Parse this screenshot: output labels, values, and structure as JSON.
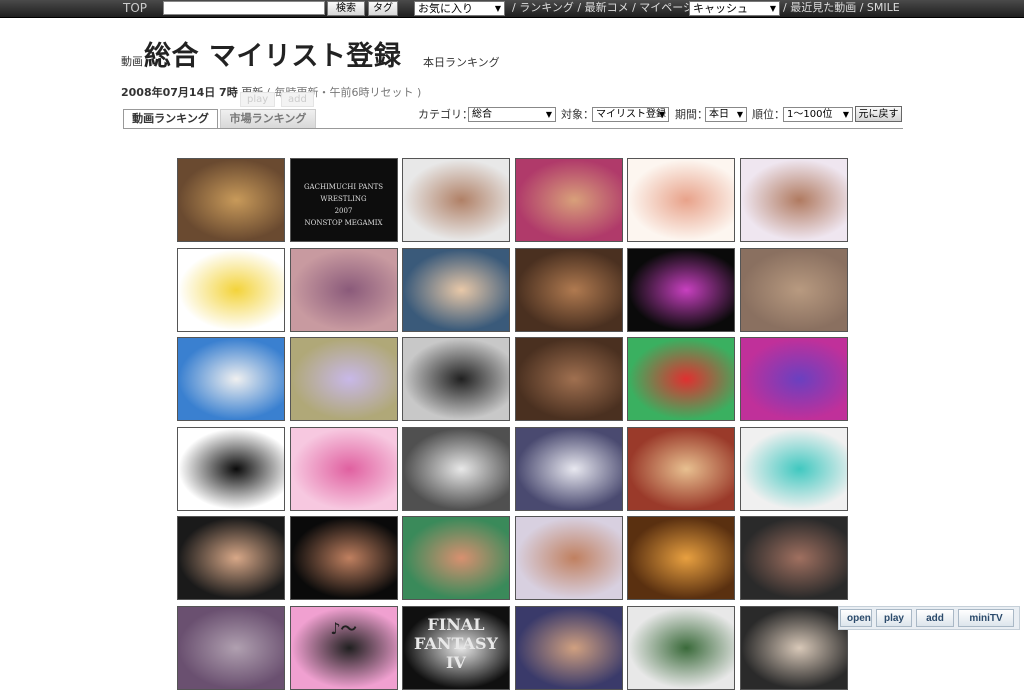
{
  "topbar": {
    "top_label": "TOP",
    "search_value": "",
    "search_button": "検索",
    "tag_button": "タグ",
    "favorites_select": "お気に入り",
    "links_text_1": "/ ランキング / 最新コメ / マイページ /",
    "cache_select": "キャッシュ",
    "links_text_2": "/ 最近見た動画 / SMILE"
  },
  "header": {
    "prefix": "動画",
    "title": "総合 マイリスト登録",
    "suffix": "本日ランキング",
    "date": "2008年07月14日 7時",
    "update_label": "更新",
    "update_note": "( 毎時更新・午前6時リセット )",
    "ghost_play": "play",
    "ghost_add": "add"
  },
  "tabs": [
    {
      "label": "動画ランキング",
      "active": true
    },
    {
      "label": "市場ランキング",
      "active": false
    }
  ],
  "filters": {
    "category_label": "カテゴリ：",
    "category_value": "総合",
    "target_label": "対象：",
    "target_value": "マイリスト登録",
    "period_label": "期間：",
    "period_value": "本日",
    "rank_label": "順位：",
    "rank_value": "1～100位",
    "reset_button": "元に戻す"
  },
  "thumbnails": [
    {
      "row": 0,
      "col": 0,
      "bg": "#6a4a30",
      "accent": "#c89a5a",
      "text": ""
    },
    {
      "row": 0,
      "col": 1,
      "bg": "#0d0d0d",
      "accent": "#0d0d0d",
      "text": "GACHIMUCHI PANTS WRESTLING\n2007\nNONSTOP MEGAMIX"
    },
    {
      "row": 0,
      "col": 2,
      "bg": "#e8e8e8",
      "accent": "#b08066",
      "text": ""
    },
    {
      "row": 0,
      "col": 3,
      "bg": "#b03a6a",
      "accent": "#d8a07a",
      "text": ""
    },
    {
      "row": 0,
      "col": 4,
      "bg": "#fdf6f0",
      "accent": "#e8a28a",
      "text": ""
    },
    {
      "row": 0,
      "col": 5,
      "bg": "#efe6f0",
      "accent": "#b07a60",
      "text": ""
    },
    {
      "row": 1,
      "col": 0,
      "bg": "#ffffff",
      "accent": "#f3d33a",
      "text": ""
    },
    {
      "row": 1,
      "col": 1,
      "bg": "#c89aa0",
      "accent": "#8a5a7a",
      "text": ""
    },
    {
      "row": 1,
      "col": 2,
      "bg": "#3a5a7a",
      "accent": "#e8c8a8",
      "text": ""
    },
    {
      "row": 1,
      "col": 3,
      "bg": "#4a3020",
      "accent": "#b07a50",
      "text": ""
    },
    {
      "row": 1,
      "col": 4,
      "bg": "#0a0a0a",
      "accent": "#c840c0",
      "text": ""
    },
    {
      "row": 1,
      "col": 5,
      "bg": "#8a7060",
      "accent": "#b89a80",
      "text": ""
    },
    {
      "row": 2,
      "col": 0,
      "bg": "#3a80d0",
      "accent": "#f0f0f0",
      "text": ""
    },
    {
      "row": 2,
      "col": 1,
      "bg": "#b0a878",
      "accent": "#c8b8e8",
      "text": ""
    },
    {
      "row": 2,
      "col": 2,
      "bg": "#c8c8c8",
      "accent": "#202020",
      "text": ""
    },
    {
      "row": 2,
      "col": 3,
      "bg": "#4a3020",
      "accent": "#a07050",
      "text": ""
    },
    {
      "row": 2,
      "col": 4,
      "bg": "#3ab060",
      "accent": "#e03030",
      "text": ""
    },
    {
      "row": 2,
      "col": 5,
      "bg": "#c0309a",
      "accent": "#6a40c0",
      "text": ""
    },
    {
      "row": 3,
      "col": 0,
      "bg": "#ffffff",
      "accent": "#0a0a0a",
      "text": ""
    },
    {
      "row": 3,
      "col": 1,
      "bg": "#f7c8e0",
      "accent": "#e060a0",
      "text": ""
    },
    {
      "row": 3,
      "col": 2,
      "bg": "#505050",
      "accent": "#e8e8e8",
      "text": ""
    },
    {
      "row": 3,
      "col": 3,
      "bg": "#4a4a70",
      "accent": "#e8e8f0",
      "text": ""
    },
    {
      "row": 3,
      "col": 4,
      "bg": "#9a3a2a",
      "accent": "#e8c090",
      "text": ""
    },
    {
      "row": 3,
      "col": 5,
      "bg": "#f0f0f0",
      "accent": "#40c8c0",
      "text": ""
    },
    {
      "row": 4,
      "col": 0,
      "bg": "#1a1a1a",
      "accent": "#d8a888",
      "text": ""
    },
    {
      "row": 4,
      "col": 1,
      "bg": "#0a0a0a",
      "accent": "#c08060",
      "text": ""
    },
    {
      "row": 4,
      "col": 2,
      "bg": "#3a8a5a",
      "accent": "#d89070",
      "text": ""
    },
    {
      "row": 4,
      "col": 3,
      "bg": "#d8d0e0",
      "accent": "#c08060",
      "text": ""
    },
    {
      "row": 4,
      "col": 4,
      "bg": "#5a3010",
      "accent": "#e8a040",
      "text": ""
    },
    {
      "row": 4,
      "col": 5,
      "bg": "#2a2a2a",
      "accent": "#a07060",
      "text": ""
    },
    {
      "row": 5,
      "col": 0,
      "bg": "#6a5070",
      "accent": "#b0a0b0",
      "text": ""
    },
    {
      "row": 5,
      "col": 1,
      "bg": "#f0a0d0",
      "accent": "#202020",
      "text": "♪～"
    },
    {
      "row": 5,
      "col": 2,
      "bg": "#101010",
      "accent": "#e8e8e8",
      "text": "FINAL FANTASY IV"
    },
    {
      "row": 5,
      "col": 3,
      "bg": "#3a3a6a",
      "accent": "#d0a080",
      "text": ""
    },
    {
      "row": 5,
      "col": 4,
      "bg": "#e8e8e8",
      "accent": "#3a6a3a",
      "text": ""
    },
    {
      "row": 5,
      "col": 5,
      "bg": "#2a2a2a",
      "accent": "#d8c8b8",
      "text": ""
    }
  ],
  "bottom_bar": {
    "open": "open",
    "play": "play",
    "add": "add",
    "minitv": "miniTV"
  }
}
